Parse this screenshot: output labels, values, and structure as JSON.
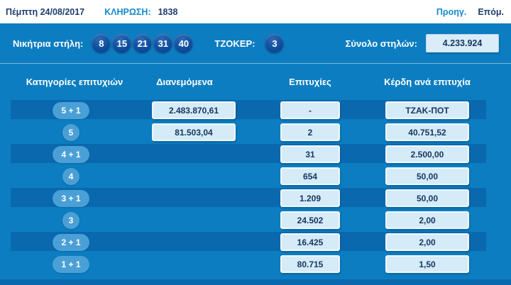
{
  "header": {
    "date": "Πέμπτη 24/08/2017",
    "draw_label": "ΚΛΗΡΩΣΗ:",
    "draw_number": "1838",
    "prev_label": "Προηγ.",
    "next_label": "Επόμ."
  },
  "banner": {
    "winning_label": "Νικήτρια στήλη:",
    "numbers": [
      "8",
      "15",
      "21",
      "31",
      "40"
    ],
    "joker_label": "ΤΖΟΚΕΡ:",
    "joker_number": "3",
    "total_label": "Σύνολο στηλών:",
    "total_value": "4.233.924"
  },
  "table": {
    "headers": [
      "Κατηγορίες επιτυχιών",
      "Διανεμόμενα",
      "Επιτυχίες",
      "Κέρδη ανά επιτυχία"
    ],
    "rows": [
      {
        "category": "5 + 1",
        "distributed": "2.483.870,61",
        "winners": "-",
        "prize": "ΤΖΑΚ-ΠΟΤ"
      },
      {
        "category": "5",
        "distributed": "81.503,04",
        "winners": "2",
        "prize": "40.751,52"
      },
      {
        "category": "4 + 1",
        "distributed": "",
        "winners": "31",
        "prize": "2.500,00"
      },
      {
        "category": "4",
        "distributed": "",
        "winners": "654",
        "prize": "50,00"
      },
      {
        "category": "3 + 1",
        "distributed": "",
        "winners": "1.209",
        "prize": "50,00"
      },
      {
        "category": "3",
        "distributed": "",
        "winners": "24.502",
        "prize": "2,00"
      },
      {
        "category": "2 + 1",
        "distributed": "",
        "winners": "16.425",
        "prize": "2,00"
      },
      {
        "category": "1 + 1",
        "distributed": "",
        "winners": "80.715",
        "prize": "1,50"
      }
    ]
  },
  "colors": {
    "panel_blue": "#0c7dc0",
    "stripe_blue": "#0a69ae",
    "ball_navy": "#0d4e9e",
    "badge_blue": "#4aa0d6",
    "box_light": "#d6ebf8",
    "text_navy": "#14365f",
    "link_blue": "#1488cf"
  }
}
